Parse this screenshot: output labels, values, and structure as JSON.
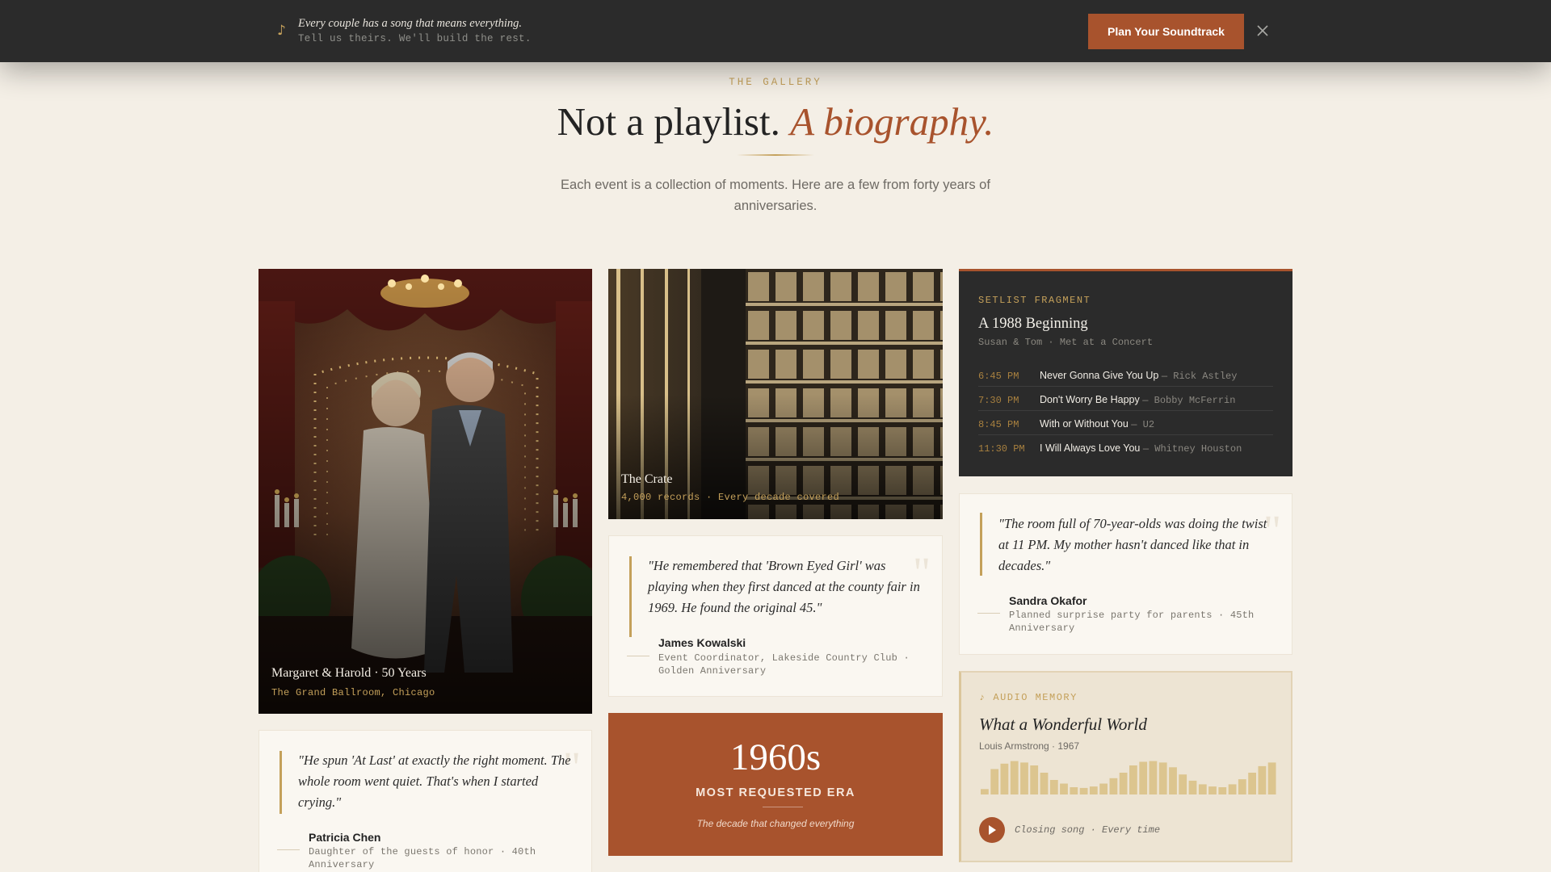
{
  "banner": {
    "note_icon": "music-note-icon",
    "line1": "Every couple has a song that means everything.",
    "line2": "Tell us theirs. We'll build the rest.",
    "cta": "Plan Your Soundtrack",
    "close_icon": "close-icon"
  },
  "header": {
    "eyebrow": "THE GALLERY",
    "title_plain": "Not a playlist.",
    "title_accent": "A biography.",
    "subtitle": "Each event is a collection of moments. Here are a few from forty years of anniversaries."
  },
  "photo_main": {
    "title": "Margaret & Harold · 50 Years",
    "subtitle": "The Grand Ballroom, Chicago"
  },
  "photo_crate": {
    "title": "The Crate",
    "subtitle": "4,000 records · Every decade covered"
  },
  "setlist": {
    "label": "SETLIST FRAGMENT",
    "title": "A 1988 Beginning",
    "subtitle": "Susan & Tom · Met at a Concert",
    "rows": [
      {
        "time": "6:45 PM",
        "song": "Never Gonna Give You Up",
        "artist": "— Rick Astley"
      },
      {
        "time": "7:30 PM",
        "song": "Don't Worry Be Happy",
        "artist": "— Bobby McFerrin"
      },
      {
        "time": "8:45 PM",
        "song": "With or Without You",
        "artist": "— U2"
      },
      {
        "time": "11:30 PM",
        "song": "I Will Always Love You",
        "artist": "— Whitney Houston"
      }
    ]
  },
  "quotes": {
    "kowalski": {
      "text": "\"He remembered that 'Brown Eyed Girl' was playing when they first danced at the county fair in 1969. He found the original 45.\"",
      "name": "James Kowalski",
      "role": "Event Coordinator, Lakeside Country Club · Golden Anniversary"
    },
    "okafor": {
      "text": "\"The room full of 70-year-olds was doing the twist at 11 PM. My mother hasn't danced like that in decades.\"",
      "name": "Sandra Okafor",
      "role": "Planned surprise party for parents · 45th Anniversary"
    },
    "chen": {
      "text": "\"He spun 'At Last' at exactly the right moment. The whole room went quiet. That's when I started crying.\"",
      "name": "Patricia Chen",
      "role": "Daughter of the guests of honor · 40th Anniversary"
    }
  },
  "stat": {
    "value": "1960s",
    "label": "MOST REQUESTED ERA",
    "tagline": "The decade that changed everything"
  },
  "audio": {
    "label": "♪ AUDIO MEMORY",
    "title": "What a Wonderful World",
    "artist": "Louis Armstrong · 1967",
    "note": "Closing song · Every time",
    "waveform": [
      0.15,
      0.7,
      0.85,
      0.92,
      0.88,
      0.8,
      0.6,
      0.4,
      0.3,
      0.2,
      0.18,
      0.22,
      0.3,
      0.45,
      0.6,
      0.8,
      0.9,
      0.92,
      0.88,
      0.75,
      0.55,
      0.38,
      0.28,
      0.22,
      0.2,
      0.28,
      0.42,
      0.6,
      0.78,
      0.88
    ]
  },
  "colors": {
    "accent": "#a8532d",
    "gold": "#c4a05a",
    "dark": "#2b2b2b",
    "background": "#f4efe6"
  }
}
